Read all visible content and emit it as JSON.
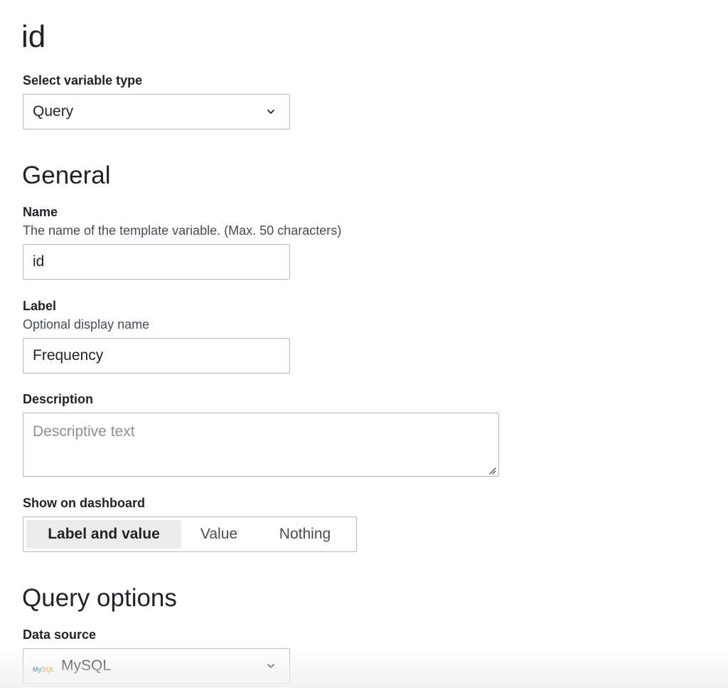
{
  "page": {
    "title": "id"
  },
  "variable_type": {
    "label": "Select variable type",
    "value": "Query",
    "icon": "chevron-down-icon"
  },
  "general": {
    "heading": "General",
    "name": {
      "label": "Name",
      "description": "The name of the template variable. (Max. 50 characters)",
      "value": "id"
    },
    "label_field": {
      "label": "Label",
      "description": "Optional display name",
      "value": "Frequency"
    },
    "description": {
      "label": "Description",
      "placeholder": "Descriptive text",
      "value": ""
    },
    "show_on_dashboard": {
      "label": "Show on dashboard",
      "options": [
        "Label and value",
        "Value",
        "Nothing"
      ],
      "selected": "Label and value"
    }
  },
  "query_options": {
    "heading": "Query options",
    "data_source": {
      "label": "Data source",
      "value": "MySQL",
      "logo_text_a": "My",
      "logo_text_b": "SQL",
      "icon": "chevron-down-icon"
    }
  },
  "colors": {
    "border": "#b5b8bd",
    "active_option_bg": "#ececec",
    "text": "#1f2328",
    "muted_text": "#464c54",
    "placeholder": "#8a8f96"
  }
}
